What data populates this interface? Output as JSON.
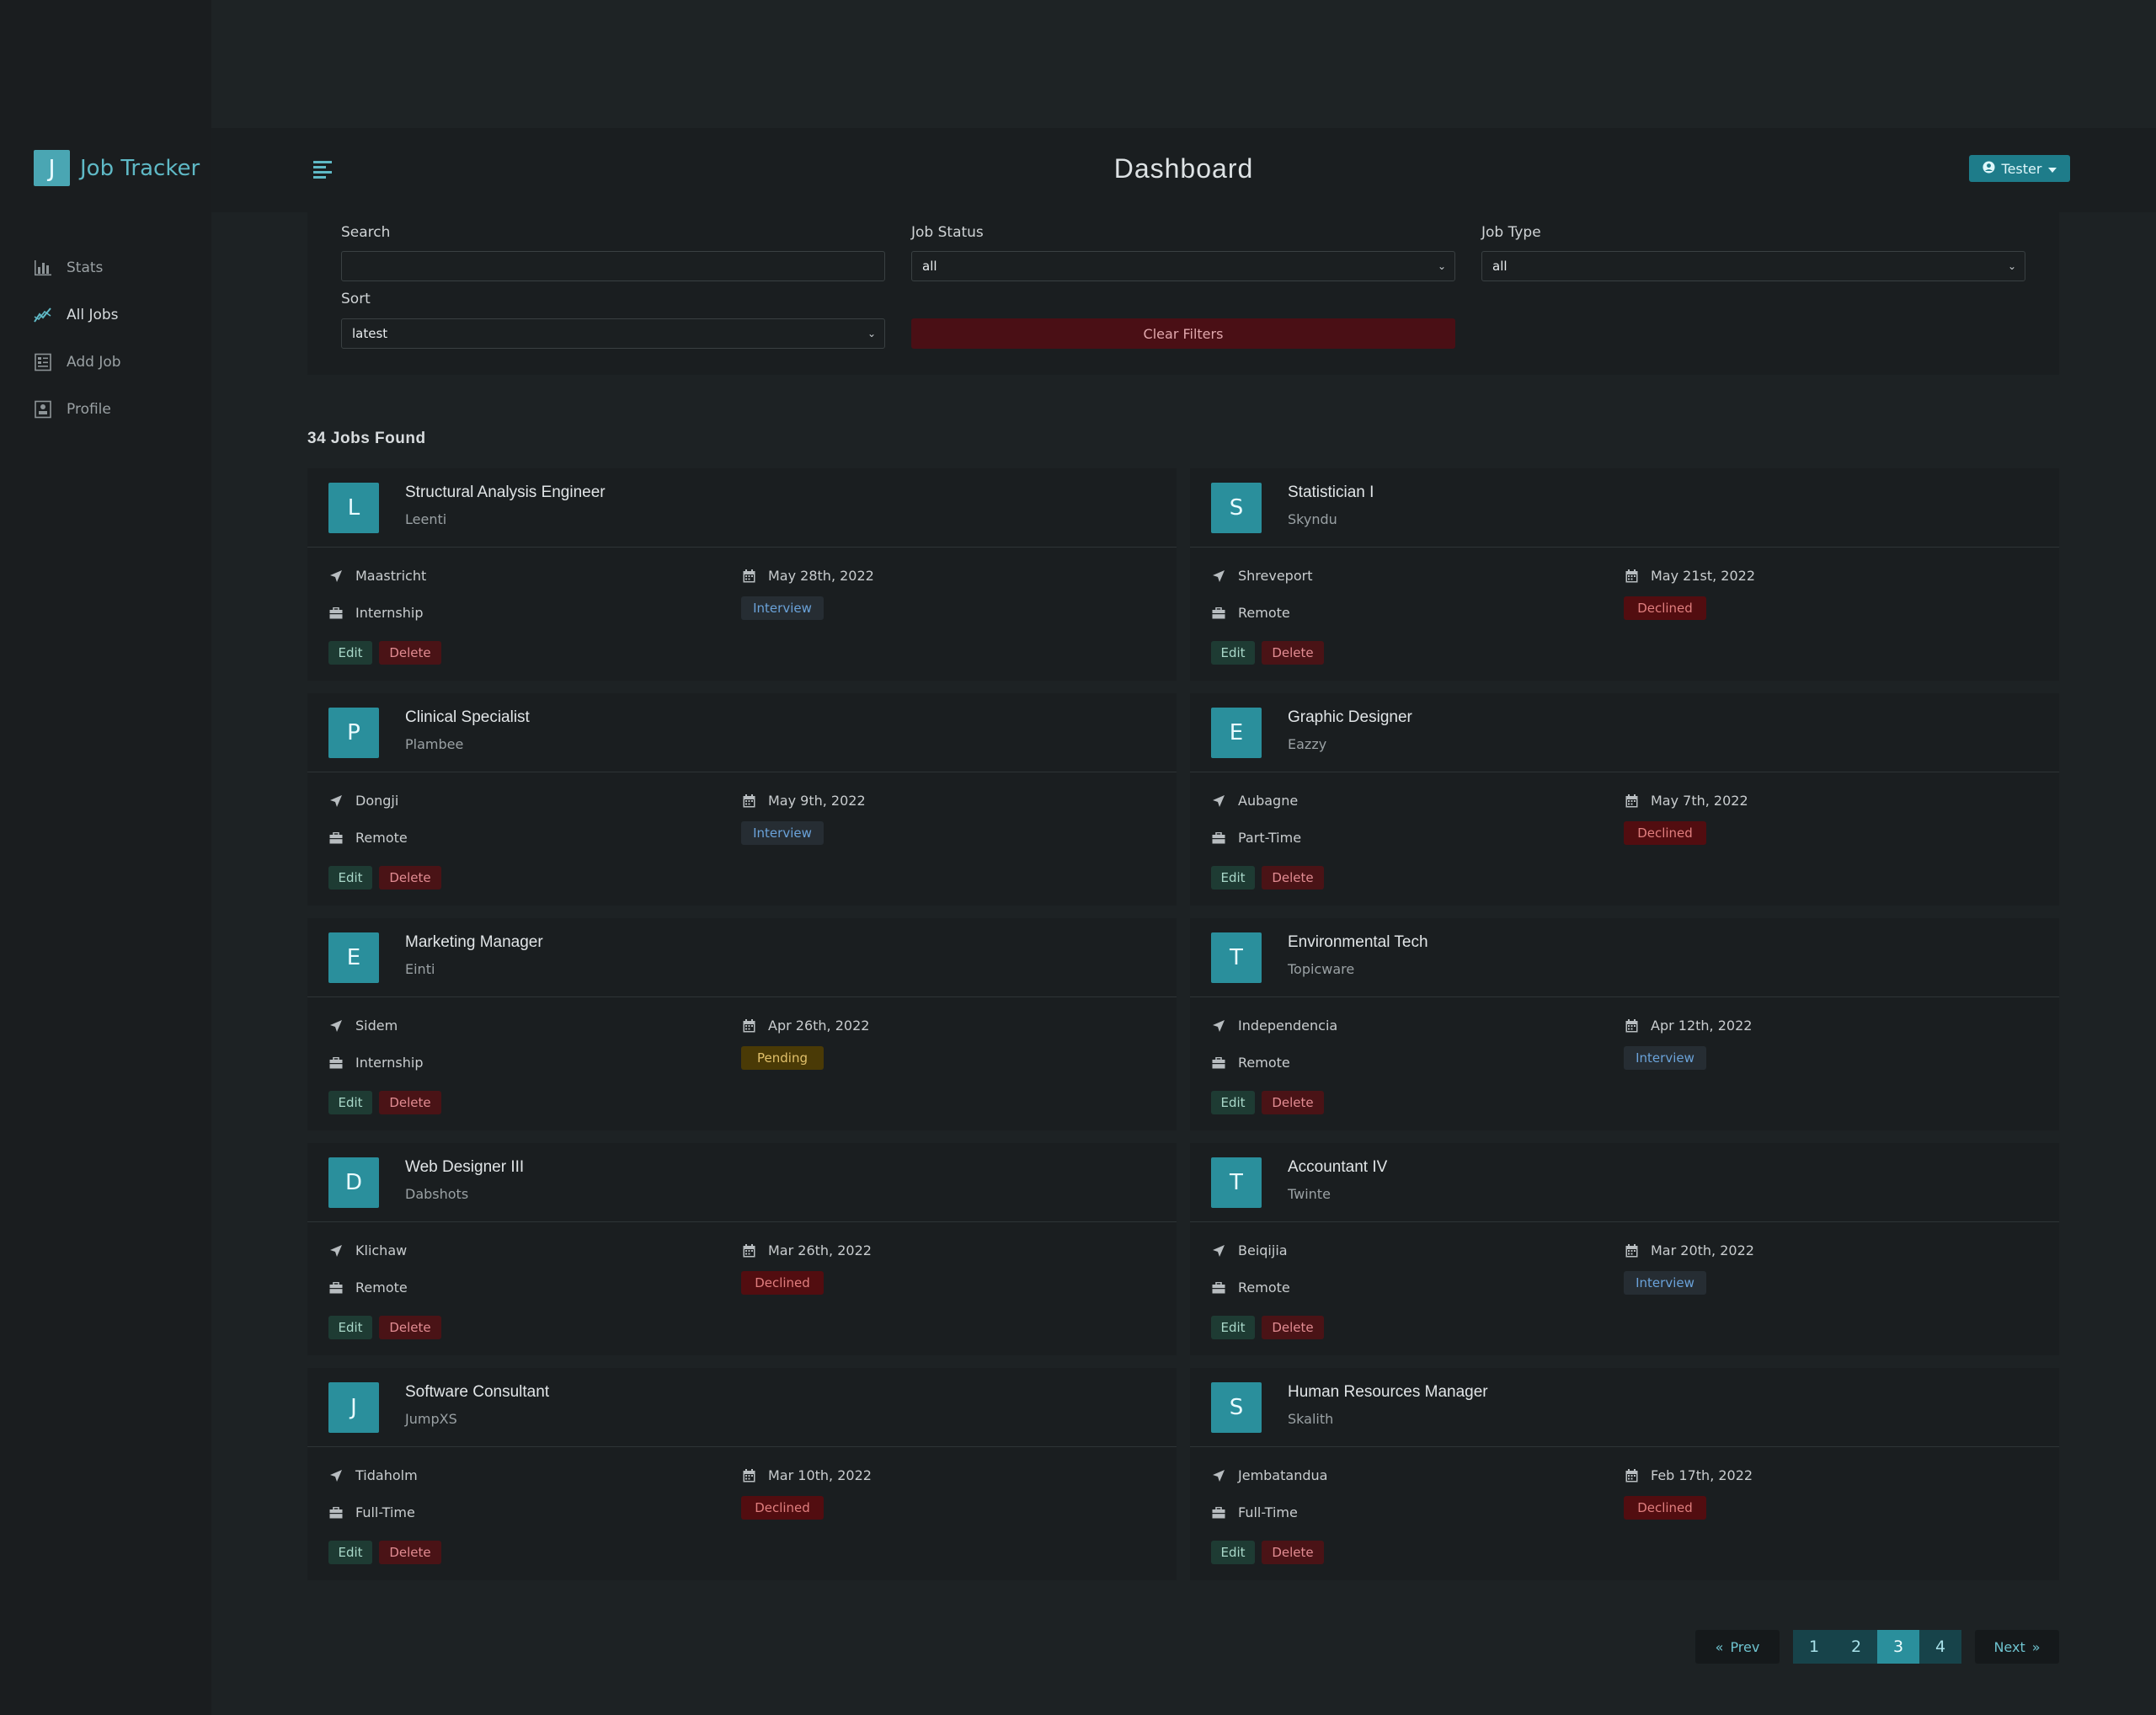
{
  "app": {
    "logo_letter": "J",
    "name": "Job Tracker"
  },
  "sidebar": {
    "items": [
      {
        "label": "Stats",
        "icon": "bar-chart-icon"
      },
      {
        "label": "All Jobs",
        "icon": "line-chart-icon",
        "active": true
      },
      {
        "label": "Add Job",
        "icon": "form-icon"
      },
      {
        "label": "Profile",
        "icon": "profile-card-icon"
      }
    ]
  },
  "header": {
    "title": "Dashboard",
    "user_label": "Tester"
  },
  "filters": {
    "search_label": "Search",
    "search_value": "",
    "status_label": "Job Status",
    "status_value": "all",
    "type_label": "Job Type",
    "type_value": "all",
    "sort_label": "Sort",
    "sort_value": "latest",
    "clear_label": "Clear Filters"
  },
  "jobs_found": "34 Jobs Found",
  "actions": {
    "edit": "Edit",
    "delete": "Delete"
  },
  "jobs": [
    {
      "letter": "L",
      "title": "Structural Analysis Engineer",
      "company": "Leenti",
      "location": "Maastricht",
      "type": "Internship",
      "date": "May 28th, 2022",
      "status": "Interview"
    },
    {
      "letter": "S",
      "title": "Statistician I",
      "company": "Skyndu",
      "location": "Shreveport",
      "type": "Remote",
      "date": "May 21st, 2022",
      "status": "Declined"
    },
    {
      "letter": "P",
      "title": "Clinical Specialist",
      "company": "Plambee",
      "location": "Dongji",
      "type": "Remote",
      "date": "May 9th, 2022",
      "status": "Interview"
    },
    {
      "letter": "E",
      "title": "Graphic Designer",
      "company": "Eazzy",
      "location": "Aubagne",
      "type": "Part-Time",
      "date": "May 7th, 2022",
      "status": "Declined"
    },
    {
      "letter": "E",
      "title": "Marketing Manager",
      "company": "Einti",
      "location": "Sidem",
      "type": "Internship",
      "date": "Apr 26th, 2022",
      "status": "Pending"
    },
    {
      "letter": "T",
      "title": "Environmental Tech",
      "company": "Topicware",
      "location": "Independencia",
      "type": "Remote",
      "date": "Apr 12th, 2022",
      "status": "Interview"
    },
    {
      "letter": "D",
      "title": "Web Designer III",
      "company": "Dabshots",
      "location": "Klichaw",
      "type": "Remote",
      "date": "Mar 26th, 2022",
      "status": "Declined"
    },
    {
      "letter": "T",
      "title": "Accountant IV",
      "company": "Twinte",
      "location": "Beiqijia",
      "type": "Remote",
      "date": "Mar 20th, 2022",
      "status": "Interview"
    },
    {
      "letter": "J",
      "title": "Software Consultant",
      "company": "JumpXS",
      "location": "Tidaholm",
      "type": "Full-Time",
      "date": "Mar 10th, 2022",
      "status": "Declined"
    },
    {
      "letter": "S",
      "title": "Human Resources Manager",
      "company": "Skalith",
      "location": "Jembatandua",
      "type": "Full-Time",
      "date": "Feb 17th, 2022",
      "status": "Declined"
    }
  ],
  "pagination": {
    "prev": "Prev",
    "next": "Next",
    "pages": [
      "1",
      "2",
      "3",
      "4"
    ],
    "current": "3"
  }
}
